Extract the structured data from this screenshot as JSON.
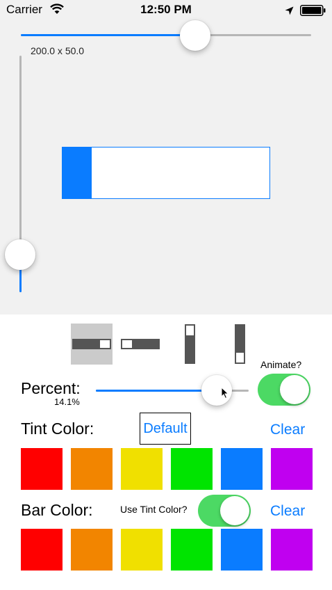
{
  "status_bar": {
    "carrier": "Carrier",
    "time": "12:50 PM"
  },
  "preview": {
    "size_label": "200.0 x 50.0",
    "width_slider_value": 0.6,
    "height_slider_value": 0.16,
    "progress_fraction": 0.141,
    "colors": {
      "accent": "#0a7cff",
      "track": "#b6b6b6",
      "background": "#f1f1f1"
    }
  },
  "orientation_buttons": [
    {
      "name": "horizontal-left",
      "selected": true
    },
    {
      "name": "horizontal-right",
      "selected": false
    },
    {
      "name": "vertical-top",
      "selected": false
    },
    {
      "name": "vertical-bottom",
      "selected": false
    }
  ],
  "controls": {
    "percent_label": "Percent:",
    "percent_value": "14.1%",
    "percent_slider_value": 0.79,
    "animate_label": "Animate?",
    "animate_on": true,
    "tint_label": "Tint Color:",
    "default_button": "Default",
    "tint_clear": "Clear",
    "bar_label": "Bar Color:",
    "use_tint_label": "Use Tint Color?",
    "use_tint_on": true,
    "bar_clear": "Clear"
  },
  "swatch_colors": [
    "#ff0000",
    "#f28500",
    "#f0e000",
    "#00e400",
    "#0a7cff",
    "#c000f0"
  ]
}
